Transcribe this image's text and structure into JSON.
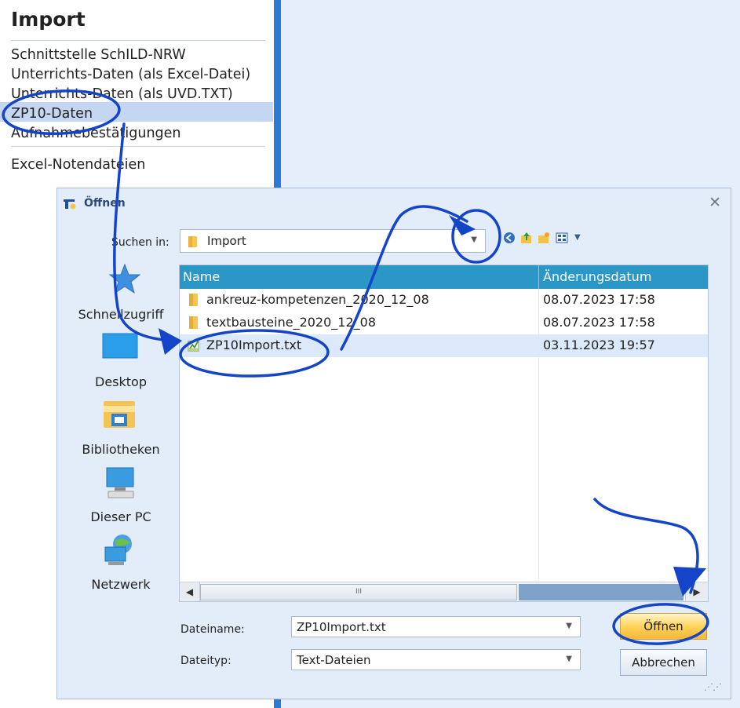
{
  "menu": {
    "title": "Import",
    "items": [
      "Schnittstelle SchILD-NRW",
      "Unterrichts-Daten (als Excel-Datei)",
      "Unterrichts-Daten (als UVD.TXT)",
      "ZP10-Daten",
      "Aufnahmebestätigungen",
      "Excel-Notendateien"
    ],
    "selected": "ZP10-Daten"
  },
  "dialog": {
    "title": "Öffnen",
    "close_label": "✕",
    "look_in_label": "Suchen in:",
    "look_in_value": "Import",
    "toolbar_icons": [
      "back-icon",
      "up-folder-icon",
      "new-folder-icon",
      "view-menu-icon"
    ],
    "places": [
      {
        "label": "Schnellzugriff",
        "icon": "star-icon"
      },
      {
        "label": "Desktop",
        "icon": "desktop-icon"
      },
      {
        "label": "Bibliotheken",
        "icon": "libraries-icon"
      },
      {
        "label": "Dieser PC",
        "icon": "computer-icon"
      },
      {
        "label": "Netzwerk",
        "icon": "network-icon"
      }
    ],
    "columns": {
      "name": "Name",
      "date": "Änderungsdatum"
    },
    "files": [
      {
        "name": "ankreuz-kompetenzen_2020_12_08",
        "date": "08.07.2023 17:58",
        "type": "folder"
      },
      {
        "name": "textbausteine_2020_12_08",
        "date": "08.07.2023 17:58",
        "type": "folder"
      },
      {
        "name": "ZP10Import.txt",
        "date": "03.11.2023 19:57",
        "type": "text-file"
      }
    ],
    "selected_file": "ZP10Import.txt",
    "scroll_thumb": "III",
    "filename_label": "Dateiname:",
    "filename_value": "ZP10Import.txt",
    "filetype_label": "Dateityp:",
    "filetype_value": "Text-Dateien",
    "open_button": "Öffnen",
    "cancel_button": "Abbrechen"
  },
  "colors": {
    "annotation": "#1445c8",
    "header": "#2a97c7",
    "panel_border": "#2c7ad6",
    "selection": "#c4d6f2"
  }
}
